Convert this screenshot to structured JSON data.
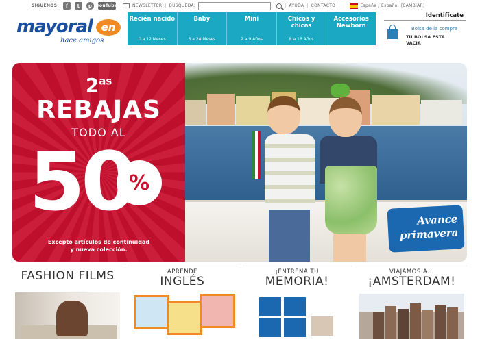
{
  "topbar": {
    "follow_label": "SÍGUENOS:",
    "social_icons": [
      "facebook-icon",
      "twitter-icon",
      "pinterest-icon",
      "youtube-icon"
    ],
    "youtube_label": "YouTube",
    "newsletter_label": "NEWSLETTER",
    "search_label": "BUSQUEDA:",
    "search_value": "",
    "help_label": "AYUDA",
    "contact_label": "CONTACTO",
    "language_label": "España / Español",
    "change_label": "(CAMBIAR)"
  },
  "logo": {
    "word": "mayoral",
    "badge": "en",
    "tagline": "hace amigos"
  },
  "nav": {
    "items": [
      {
        "label": "Recién nacido",
        "sub": "0 a 12 Meses"
      },
      {
        "label": "Baby",
        "sub": "3 a 24 Meses"
      },
      {
        "label": "Mini",
        "sub": "2 a 9 Años"
      },
      {
        "label": "Chicos y chicas",
        "sub": "8 a 16 Años"
      },
      {
        "label": "Accesorios Newborn",
        "sub": ""
      }
    ]
  },
  "account": {
    "identify_label": "Identifícate",
    "cart_link": "Bolsa de la compra",
    "cart_status": "TU BOLSA ESTA VACIA"
  },
  "promo": {
    "ordinal": "2",
    "ordinal_suffix": "as",
    "headline": "REBAJAS",
    "subhead": "TODO AL",
    "discount": "50",
    "percent": "%",
    "note_line1": "Excepto artículos de continuidad",
    "note_line2": "y nueva colección."
  },
  "hero_photo": {
    "tag_line1": "Avance",
    "tag_line2": "primavera"
  },
  "tiles": [
    {
      "line1": "",
      "line2": "FASHION FILMS"
    },
    {
      "line1": "APRENDE",
      "line2": "INGLÉS"
    },
    {
      "line1": "¡ENTRENA TU",
      "line2": "MEMORIA!"
    },
    {
      "line1": "VIAJAMOS A...",
      "line2": "¡AMSTERDAM!"
    }
  ],
  "colors": {
    "brand_blue": "#1a4fa0",
    "nav_teal": "#1ba8c2",
    "promo_red": "#c8102e",
    "accent_orange": "#f08a24",
    "tag_blue": "#1b67b0"
  }
}
